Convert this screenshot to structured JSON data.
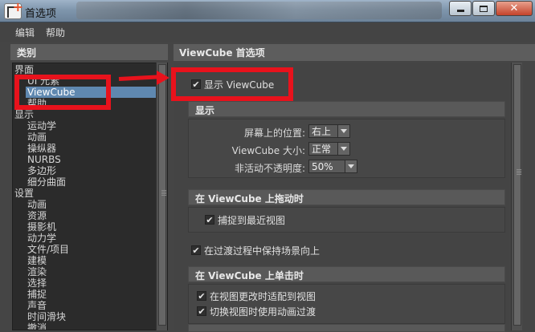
{
  "window": {
    "title": "首选项",
    "close_glyph": "✕"
  },
  "menu": [
    "编辑",
    "帮助"
  ],
  "categories": {
    "header": "类别",
    "items": [
      {
        "label": "界面",
        "level": 0
      },
      {
        "label": "UI 元素",
        "level": 1
      },
      {
        "label": "ViewCube",
        "level": 1,
        "selected": true
      },
      {
        "label": "帮助",
        "level": 1
      },
      {
        "label": "显示",
        "level": 0
      },
      {
        "label": "运动学",
        "level": 1
      },
      {
        "label": "动画",
        "level": 1
      },
      {
        "label": "操纵器",
        "level": 1
      },
      {
        "label": "NURBS",
        "level": 1
      },
      {
        "label": "多边形",
        "level": 1
      },
      {
        "label": "细分曲面",
        "level": 1
      },
      {
        "label": "设置",
        "level": 0
      },
      {
        "label": "动画",
        "level": 1
      },
      {
        "label": "资源",
        "level": 1
      },
      {
        "label": "摄影机",
        "level": 1
      },
      {
        "label": "动力学",
        "level": 1
      },
      {
        "label": "文件/项目",
        "level": 1
      },
      {
        "label": "建模",
        "level": 1
      },
      {
        "label": "渲染",
        "level": 1
      },
      {
        "label": "选择",
        "level": 1
      },
      {
        "label": "捕捉",
        "level": 1
      },
      {
        "label": "声音",
        "level": 1
      },
      {
        "label": "时间滑块",
        "level": 1
      },
      {
        "label": "撤消",
        "level": 1
      }
    ]
  },
  "viewcube": {
    "header": "ViewCube 首选项",
    "show_viewcube": {
      "label": "显示 ViewCube",
      "checked": true
    },
    "display": {
      "header": "显示",
      "position_label": "屏幕上的位置:",
      "position_value": "右上",
      "size_label": "ViewCube 大小:",
      "size_value": "正常",
      "opacity_label": "非活动不透明度:",
      "opacity_value": "50%"
    },
    "drag": {
      "header": "在 ViewCube 上拖动时",
      "snap": {
        "label": "捕捉到最近视图",
        "checked": true
      }
    },
    "keep_upright": {
      "label": "在过渡过程中保持场景向上",
      "checked": true
    },
    "click": {
      "header": "在 ViewCube 上单击时",
      "fit": {
        "label": "在视图更改时适配到视图",
        "checked": true
      },
      "animate": {
        "label": "切换视图时使用动画过渡",
        "checked": true
      }
    },
    "check_glyph": "✔"
  },
  "annotation_color": "#e8121c"
}
